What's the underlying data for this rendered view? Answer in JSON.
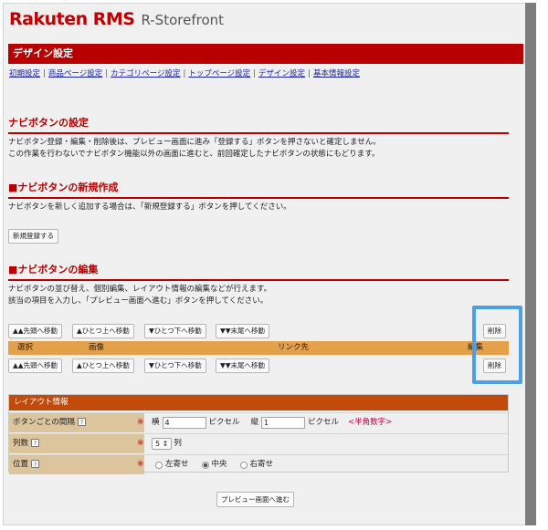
{
  "logo": {
    "brand": "Rakuten RMS",
    "sub": "R-Storefront"
  },
  "page": {
    "title": "デザイン設定"
  },
  "nav": [
    "初期設定",
    "商品ページ設定",
    "カテゴリページ設定",
    "トップページ設定",
    "デザイン設定",
    "基本情報設定"
  ],
  "navi": {
    "heading": "ナビボタンの設定",
    "line1": "ナビボタン登録・編集・削除後は、プレビュー画面に進み「登録する」ボタンを押さないと確定しません。",
    "line2": "この作業を行わないでナビボタン機能以外の画面に進むと、前回確定したナビボタンの状態にもどります。"
  },
  "create": {
    "heading": "■ナビボタンの新規作成",
    "line1": "ナビボタンを新しく追加する場合は、「新規登録する」ボタンを押してください。",
    "button": "新規登録する"
  },
  "edit": {
    "heading": "■ナビボタンの編集",
    "line1": "ナビボタンの並び替え、個別編集、レイアウト情報の編集などが行えます。",
    "line2": "該当の項目を入力し、「プレビュー画面へ進む」ボタンを押してください。",
    "move": {
      "top": "▲▲先頭へ移動",
      "up": "▲ひとつ上へ移動",
      "down": "▼ひとつ下へ移動",
      "bottom": "▼▼末尾へ移動"
    },
    "delete": "削除",
    "columns": {
      "select": "選択",
      "image": "画像",
      "link": "リンク先",
      "edit": "編集"
    }
  },
  "layout": {
    "title": "レイアウト情報",
    "req_mark": "※",
    "q_mark": "?",
    "spacing": {
      "label": "ボタンごとの間隔",
      "h_label": "横",
      "h_value": "4",
      "unit": "ピクセル",
      "v_label": "縦",
      "v_value": "1",
      "hint": "<半角数字>"
    },
    "columns": {
      "label": "列数",
      "value": "5",
      "suffix": "列"
    },
    "position": {
      "label": "位置",
      "options": [
        "左寄せ",
        "中央",
        "右寄せ"
      ],
      "selected": "中央"
    }
  },
  "preview_button": "プレビュー画面へ進む",
  "colors": {
    "brand": "#bf0000",
    "title_bar": "#b80000",
    "table_header": "#e4a04a",
    "layout_header": "#c24a0b",
    "highlight": "#4a9fe6"
  }
}
